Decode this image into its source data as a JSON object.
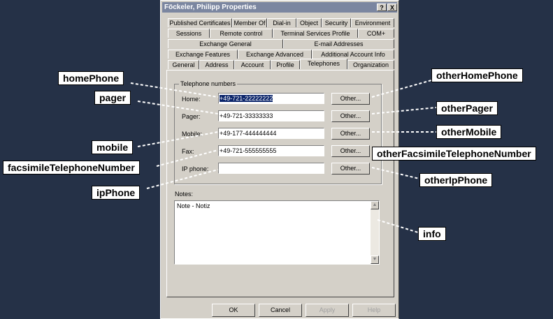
{
  "window": {
    "title": "Föckeler, Philipp Properties",
    "help_button": "?",
    "close_button": "X"
  },
  "tabs": {
    "row1": [
      "Published Certificates",
      "Member Of",
      "Dial-in",
      "Object",
      "Security",
      "Environment"
    ],
    "row2": [
      "Sessions",
      "Remote control",
      "Terminal Services Profile",
      "COM+"
    ],
    "row3": [
      "Exchange General",
      "E-mail Addresses"
    ],
    "row4": [
      "Exchange Features",
      "Exchange Advanced",
      "Additional Account Info"
    ],
    "row5": [
      "General",
      "Address",
      "Account",
      "Profile",
      "Telephones",
      "Organization"
    ],
    "selected": "Telephones"
  },
  "telephone_numbers": {
    "group_label": "Telephone numbers",
    "rows": [
      {
        "label": "Home:",
        "value": "+49-721-22222222",
        "button": "Other..."
      },
      {
        "label": "Pager:",
        "value": "+49-721-33333333",
        "button": "Other..."
      },
      {
        "label": "Mobile:",
        "value": "+49-177-444444444",
        "button": "Other..."
      },
      {
        "label": "Fax:",
        "value": "+49-721-555555555",
        "button": "Other..."
      },
      {
        "label": "IP phone:",
        "value": "",
        "button": "Other..."
      }
    ]
  },
  "notes": {
    "label": "Notes:",
    "value": "Note - Notiz"
  },
  "footer": {
    "ok": "OK",
    "cancel": "Cancel",
    "apply": "Apply",
    "help": "Help"
  },
  "callouts": {
    "homePhone": "homePhone",
    "pager": "pager",
    "mobile": "mobile",
    "facsimileTelephoneNumber": "facsimileTelephoneNumber",
    "ipPhone": "ipPhone",
    "otherHomePhone": "otherHomePhone",
    "otherPager": "otherPager",
    "otherMobile": "otherMobile",
    "otherFacsimileTelephoneNumber": "otherFacsimileTelephoneNumber",
    "otherIpPhone": "otherIpPhone",
    "info": "info"
  },
  "colors": {
    "background": "#253147",
    "dialog": "#d4d0c8",
    "selection": "#0a246a"
  }
}
